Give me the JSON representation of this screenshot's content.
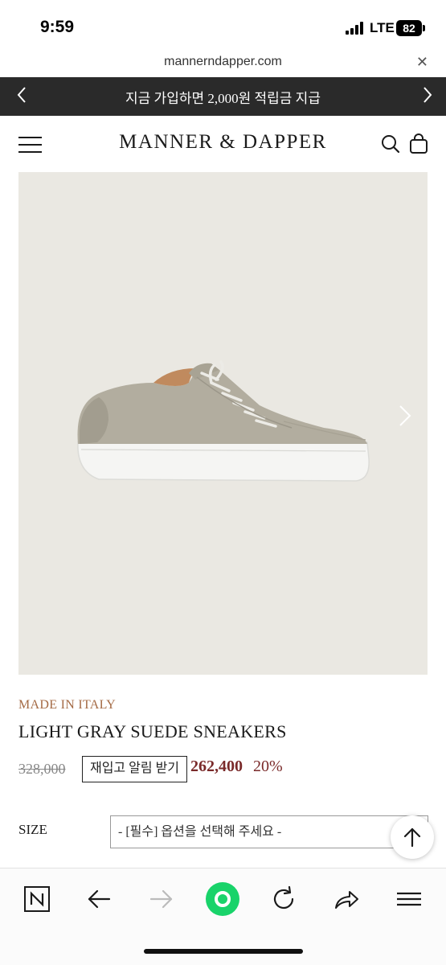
{
  "status_bar": {
    "time": "9:59",
    "network": "LTE",
    "battery": "82"
  },
  "browser": {
    "url": "mannerndapper.com",
    "close_icon": "close-icon"
  },
  "promo": {
    "text": "지금 가입하면 2,000원 적립금 지급"
  },
  "header": {
    "logo": "MANNER & DAPPER"
  },
  "product": {
    "origin": "MADE IN ITALY",
    "name": "LIGHT GRAY SUEDE SNEAKERS",
    "original_price": "328,000",
    "restock_button": "재입고 알림 받기",
    "sale_price": "262,400",
    "discount": "20%",
    "size_label": "SIZE",
    "size_placeholder": "- [필수] 옵션을 선택해 주세요 -"
  },
  "colors": {
    "promo_bg": "#2a2a2a",
    "origin_text": "#a46a44",
    "sale_price": "#7a2a2a",
    "image_bg": "#eae8e2",
    "browser_accent": "#19d36a"
  }
}
